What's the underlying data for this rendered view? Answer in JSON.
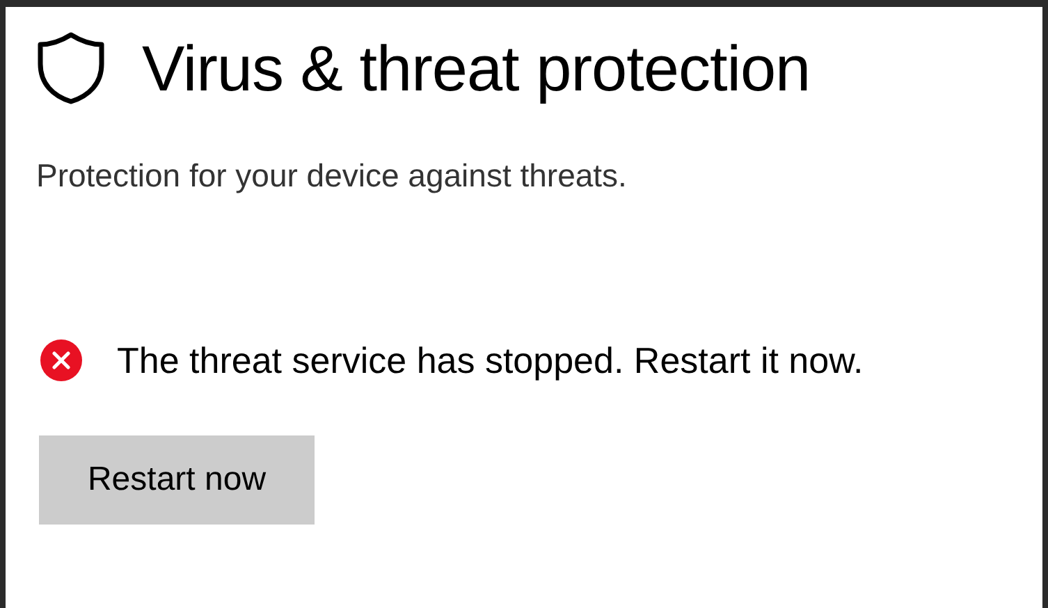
{
  "header": {
    "title": "Virus & threat protection",
    "subtitle": "Protection for your device against threats."
  },
  "alert": {
    "kind": "error",
    "message": "The threat service has stopped. Restart it now."
  },
  "button": {
    "label": "Restart now"
  }
}
